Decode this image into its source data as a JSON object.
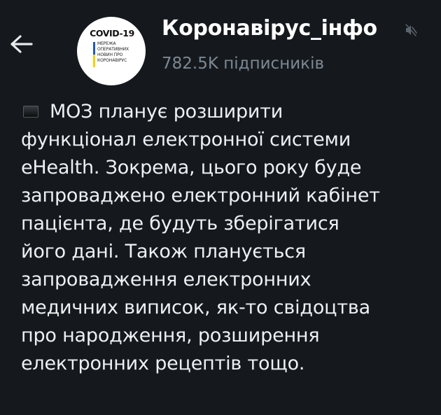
{
  "header": {
    "channel_name": "Коронавірус_інфо",
    "subscribers": "782.5K підписників",
    "avatar": {
      "title": "COVID-19",
      "lines": [
        "МЕРЕЖА",
        "ОПЕРАТИВНИХ",
        "НОВИН ПРО",
        "КОРОНАВІРУС"
      ]
    },
    "icons": {
      "back": "arrow-left-icon",
      "mute": "muted-speaker-icon"
    }
  },
  "message": {
    "bullet_icon": "black-square-icon",
    "lines": [
      "МОЗ планує розширити",
      "функціонал електронної системи",
      "eHealth. Зокрема, цього року буде",
      "запроваджено електронний кабінет",
      "пацієнта, де будуть зберігатися",
      "його дані. Також планується",
      "запровадження електронних",
      "медичних виписок, як-то свідоцтва",
      "про народження, розширення",
      "електронних рецептів тощо."
    ]
  },
  "colors": {
    "background": "#15191e",
    "text": "#eef0f2",
    "muted_text": "#7d8893"
  }
}
